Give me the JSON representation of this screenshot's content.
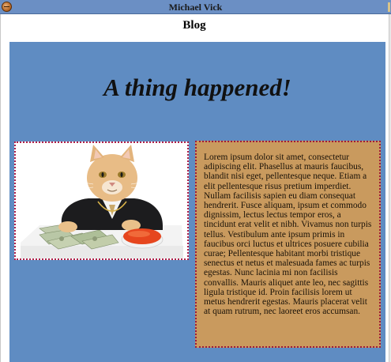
{
  "window": {
    "title": "Michael Vick"
  },
  "page": {
    "header": "Blog",
    "headline": "A thing happened!",
    "photo_alt": "Cat in a suit at a desk with money and caviar",
    "body": "Lorem ipsum dolor sit amet, consectetur adipiscing elit. Phasellus at mauris faucibus, blandit nisi eget, pellentesque neque. Etiam a elit pellentesque risus pretium imperdiet. Nullam facilisis sapien eu diam consequat hendrerit. Fusce aliquam, ipsum et commodo dignissim, lectus lectus tempor eros, a tincidunt erat velit et nibh. Vivamus non turpis tellus. Vestibulum ante ipsum primis in faucibus orci luctus et ultrices posuere cubilia curae; Pellentesque habitant morbi tristique senectus et netus et malesuada fames ac turpis egestas. Nunc lacinia mi non facilisis convallis. Mauris aliquet ante leo, nec sagittis ligula tristique id. Proin facilisis lorem ut metus hendrerit egestas. Mauris placerat velit at quam rutrum, nec laoreet eros accumsan."
  },
  "colors": {
    "titlebar": "#6b8fc4",
    "content_bg": "#5f8cc2",
    "text_box_bg": "#c99a5e",
    "dotted_border": "#b0204a"
  },
  "icons": {
    "app": "firefox-like-app-icon"
  }
}
